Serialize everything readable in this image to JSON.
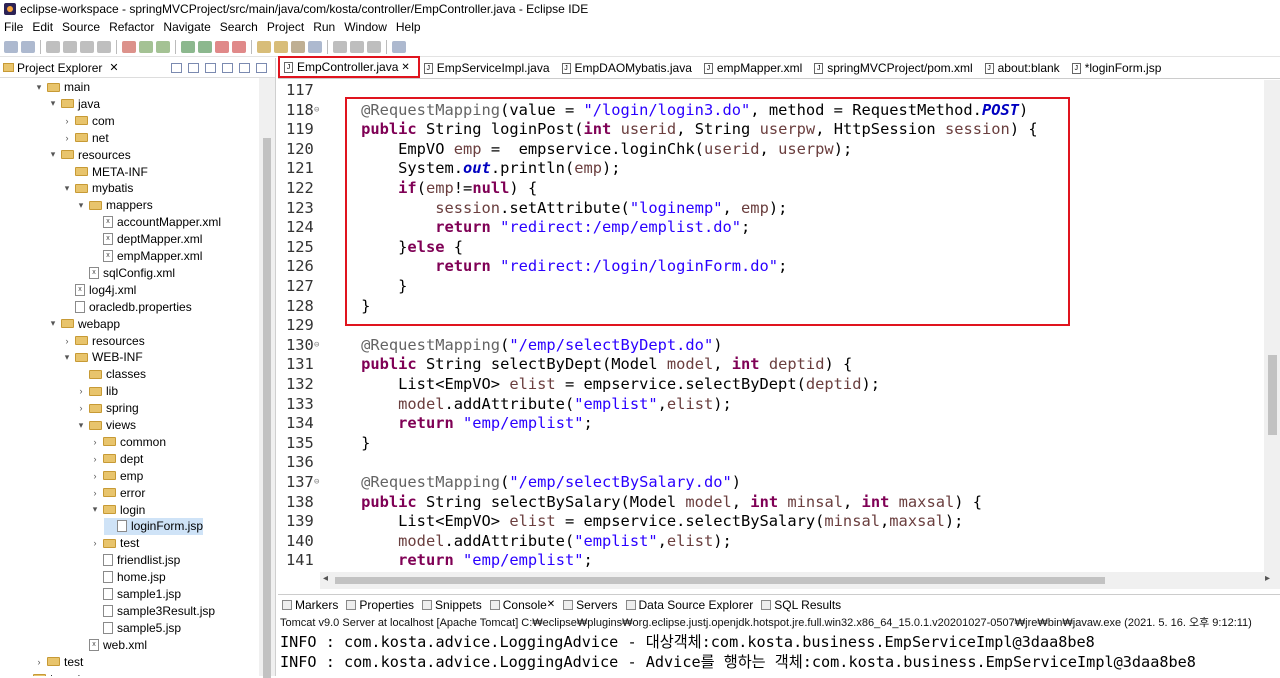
{
  "window": {
    "title": "eclipse-workspace - springMVCProject/src/main/java/com/kosta/controller/EmpController.java - Eclipse IDE"
  },
  "menu": [
    "File",
    "Edit",
    "Source",
    "Refactor",
    "Navigate",
    "Search",
    "Project",
    "Run",
    "Window",
    "Help"
  ],
  "explorer": {
    "title": "Project Explorer",
    "items": [
      {
        "label": "main",
        "depth": 3,
        "kind": "folder",
        "expanded": true
      },
      {
        "label": "java",
        "depth": 4,
        "kind": "folder",
        "expanded": true
      },
      {
        "label": "com",
        "depth": 5,
        "kind": "folder",
        "expanded": false
      },
      {
        "label": "net",
        "depth": 5,
        "kind": "folder",
        "expanded": false
      },
      {
        "label": "resources",
        "depth": 4,
        "kind": "folder",
        "expanded": true
      },
      {
        "label": "META-INF",
        "depth": 5,
        "kind": "folder",
        "expanded": null
      },
      {
        "label": "mybatis",
        "depth": 5,
        "kind": "folder",
        "expanded": true
      },
      {
        "label": "mappers",
        "depth": 6,
        "kind": "folder",
        "expanded": true
      },
      {
        "label": "accountMapper.xml",
        "depth": 7,
        "kind": "file",
        "expanded": null
      },
      {
        "label": "deptMapper.xml",
        "depth": 7,
        "kind": "file",
        "expanded": null
      },
      {
        "label": "empMapper.xml",
        "depth": 7,
        "kind": "file",
        "expanded": null
      },
      {
        "label": "sqlConfig.xml",
        "depth": 6,
        "kind": "file",
        "expanded": null
      },
      {
        "label": "log4j.xml",
        "depth": 5,
        "kind": "file",
        "expanded": null
      },
      {
        "label": "oracledb.properties",
        "depth": 5,
        "kind": "file",
        "expanded": null
      },
      {
        "label": "webapp",
        "depth": 4,
        "kind": "folder",
        "expanded": true
      },
      {
        "label": "resources",
        "depth": 5,
        "kind": "folder",
        "expanded": false
      },
      {
        "label": "WEB-INF",
        "depth": 5,
        "kind": "folder",
        "expanded": true
      },
      {
        "label": "classes",
        "depth": 6,
        "kind": "folder",
        "expanded": null
      },
      {
        "label": "lib",
        "depth": 6,
        "kind": "folder",
        "expanded": false
      },
      {
        "label": "spring",
        "depth": 6,
        "kind": "folder",
        "expanded": false
      },
      {
        "label": "views",
        "depth": 6,
        "kind": "folder",
        "expanded": true
      },
      {
        "label": "common",
        "depth": 7,
        "kind": "folder",
        "expanded": false
      },
      {
        "label": "dept",
        "depth": 7,
        "kind": "folder",
        "expanded": false
      },
      {
        "label": "emp",
        "depth": 7,
        "kind": "folder",
        "expanded": false
      },
      {
        "label": "error",
        "depth": 7,
        "kind": "folder",
        "expanded": false
      },
      {
        "label": "login",
        "depth": 7,
        "kind": "folder",
        "expanded": true
      },
      {
        "label": "loginForm.jsp",
        "depth": 8,
        "kind": "file",
        "expanded": null,
        "selected": true
      },
      {
        "label": "test",
        "depth": 7,
        "kind": "folder",
        "expanded": false
      },
      {
        "label": "friendlist.jsp",
        "depth": 7,
        "kind": "file",
        "expanded": null
      },
      {
        "label": "home.jsp",
        "depth": 7,
        "kind": "file",
        "expanded": null
      },
      {
        "label": "sample1.jsp",
        "depth": 7,
        "kind": "file",
        "expanded": null
      },
      {
        "label": "sample3Result.jsp",
        "depth": 7,
        "kind": "file",
        "expanded": null
      },
      {
        "label": "sample5.jsp",
        "depth": 7,
        "kind": "file",
        "expanded": null
      },
      {
        "label": "web.xml",
        "depth": 6,
        "kind": "file",
        "expanded": null
      },
      {
        "label": "test",
        "depth": 3,
        "kind": "folder",
        "expanded": false
      },
      {
        "label": "target",
        "depth": 2,
        "kind": "folder",
        "expanded": false
      }
    ]
  },
  "tabs": [
    {
      "label": "EmpController.java",
      "active": true
    },
    {
      "label": "EmpServiceImpl.java",
      "active": false
    },
    {
      "label": "EmpDAOMybatis.java",
      "active": false
    },
    {
      "label": "empMapper.xml",
      "active": false
    },
    {
      "label": "springMVCProject/pom.xml",
      "active": false
    },
    {
      "label": "about:blank",
      "active": false
    },
    {
      "label": "*loginForm.jsp",
      "active": false
    }
  ],
  "code": [
    {
      "n": "117",
      "fold": "",
      "text": ""
    },
    {
      "n": "118",
      "fold": "⊖",
      "text": "    @RequestMapping(value = \"/login/login3.do\", method = RequestMethod.POST)"
    },
    {
      "n": "119",
      "fold": "",
      "text": "    public String loginPost(int userid, String userpw, HttpSession session) {"
    },
    {
      "n": "120",
      "fold": "",
      "text": "        EmpVO emp =  empservice.loginChk(userid, userpw);"
    },
    {
      "n": "121",
      "fold": "",
      "text": "        System.out.println(emp);"
    },
    {
      "n": "122",
      "fold": "",
      "text": "        if(emp!=null) {"
    },
    {
      "n": "123",
      "fold": "",
      "text": "            session.setAttribute(\"loginemp\", emp);"
    },
    {
      "n": "124",
      "fold": "",
      "text": "            return \"redirect:/emp/emplist.do\";"
    },
    {
      "n": "125",
      "fold": "",
      "text": "        }else {"
    },
    {
      "n": "126",
      "fold": "",
      "text": "            return \"redirect:/login/loginForm.do\";"
    },
    {
      "n": "127",
      "fold": "",
      "text": "        }"
    },
    {
      "n": "128",
      "fold": "",
      "text": "    }"
    },
    {
      "n": "129",
      "fold": "",
      "text": ""
    },
    {
      "n": "130",
      "fold": "⊖",
      "text": "    @RequestMapping(\"/emp/selectByDept.do\")"
    },
    {
      "n": "131",
      "fold": "",
      "text": "    public String selectByDept(Model model, int deptid) {"
    },
    {
      "n": "132",
      "fold": "",
      "text": "        List<EmpVO> elist = empservice.selectByDept(deptid);"
    },
    {
      "n": "133",
      "fold": "",
      "text": "        model.addAttribute(\"emplist\",elist);"
    },
    {
      "n": "134",
      "fold": "",
      "text": "        return \"emp/emplist\";"
    },
    {
      "n": "135",
      "fold": "",
      "text": "    }"
    },
    {
      "n": "136",
      "fold": "",
      "text": ""
    },
    {
      "n": "137",
      "fold": "⊖",
      "text": "    @RequestMapping(\"/emp/selectBySalary.do\")"
    },
    {
      "n": "138",
      "fold": "",
      "text": "    public String selectBySalary(Model model, int minsal, int maxsal) {"
    },
    {
      "n": "139",
      "fold": "",
      "text": "        List<EmpVO> elist = empservice.selectBySalary(minsal,maxsal);"
    },
    {
      "n": "140",
      "fold": "",
      "text": "        model.addAttribute(\"emplist\",elist);"
    },
    {
      "n": "141",
      "fold": "",
      "text": "        return \"emp/emplist\";"
    }
  ],
  "console": {
    "tabs": [
      "Markers",
      "Properties",
      "Snippets",
      "Console",
      "Servers",
      "Data Source Explorer",
      "SQL Results"
    ],
    "status": "Tomcat v9.0 Server at localhost [Apache Tomcat] C:₩eclipse₩plugins₩org.eclipse.justj.openjdk.hotspot.jre.full.win32.x86_64_15.0.1.v20201027-0507₩jre₩bin₩javaw.exe  (2021. 5. 16. 오후 9:12:11)",
    "lines": [
      "INFO : com.kosta.advice.LoggingAdvice - 대상객체:com.kosta.business.EmpServiceImpl@3daa8be8",
      "INFO : com.kosta.advice.LoggingAdvice - Advice를 행하는 객체:com.kosta.business.EmpServiceImpl@3daa8be8"
    ]
  },
  "colors": {
    "highlight": "#e0141e",
    "keyword": "#7f0055",
    "string": "#2a00ff",
    "annotation": "#646464"
  }
}
